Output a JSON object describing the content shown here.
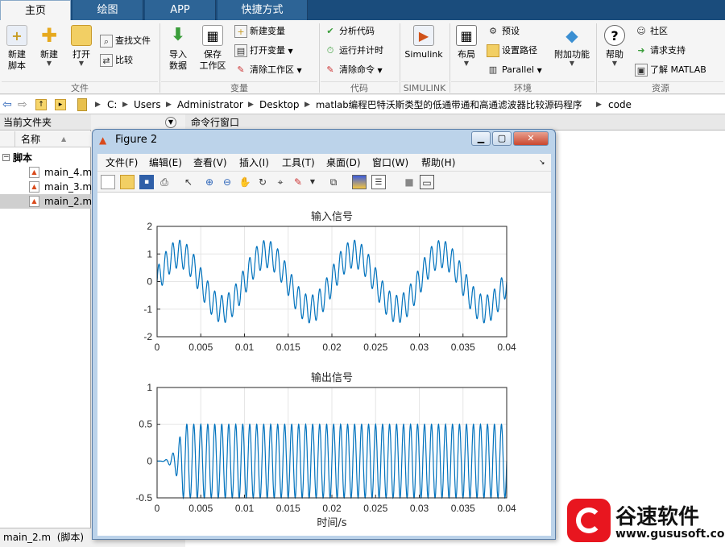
{
  "tabs": [
    {
      "label": "主页"
    },
    {
      "label": "绘图"
    },
    {
      "label": "APP"
    },
    {
      "label": "快捷方式"
    }
  ],
  "ribbon": {
    "new_script": "新建\n脚本",
    "new": "新建",
    "open": "打开",
    "find_files": "查找文件",
    "compare": "比较",
    "import_data": "导入\n数据",
    "save_workspace": "保存\n工作区",
    "new_variable": "新建变量",
    "open_variable": "打开变量",
    "clear_workspace": "清除工作区",
    "analyze_code": "分析代码",
    "run_and_time": "运行并计时",
    "clear_commands": "清除命令",
    "simulink": "Simulink",
    "layout": "布局",
    "preferences": "预设",
    "set_path": "设置路径",
    "parallel": "Parallel",
    "addons": "附加功能",
    "help": "帮助",
    "community": "社区",
    "request_support": "请求支持",
    "learn_matlab": "了解 MATLAB",
    "groups": {
      "file": "文件",
      "variable": "变量",
      "code": "代码",
      "simulink": "SIMULINK",
      "environment": "环境",
      "resources": "资源"
    }
  },
  "address": {
    "segments": [
      "C:",
      "Users",
      "Administrator",
      "Desktop",
      "matlab编程巴特沃斯类型的低通带通和高通滤波器比较源码程序",
      "code"
    ]
  },
  "left_panel": {
    "title": "当前文件夹",
    "column": "名称",
    "sort_marker": "▲",
    "group": "脚本",
    "files": [
      "main_4.m",
      "main_3.m",
      "main_2.m"
    ],
    "status": "main_2.m  (脚本)"
  },
  "command_window": {
    "title": "命令行窗口"
  },
  "figure": {
    "title": "Figure 2",
    "menu": [
      "文件(F)",
      "编辑(E)",
      "查看(V)",
      "插入(I)",
      "工具(T)",
      "桌面(D)",
      "窗口(W)",
      "帮助(H)"
    ],
    "toolbar_icons": [
      "new-figure-icon",
      "open-icon",
      "save-icon",
      "print-icon",
      "pointer-icon",
      "zoom-in-icon",
      "zoom-out-icon",
      "pan-icon",
      "rotate-icon",
      "datatip-icon",
      "brush-icon",
      "link-icon",
      "colorbar-icon",
      "legend-icon",
      "hide-tools-icon",
      "show-tools-icon"
    ]
  },
  "chart_data": [
    {
      "type": "line",
      "title": "输入信号",
      "xlabel": "",
      "ylabel": "",
      "xlim": [
        0,
        0.04
      ],
      "ylim": [
        -2,
        2
      ],
      "xticks": [
        "0",
        "0.005",
        "0.01",
        "0.015",
        "0.02",
        "0.025",
        "0.03",
        "0.035",
        "0.04"
      ],
      "yticks": [
        "2",
        "1",
        "0",
        "-1",
        "-2"
      ],
      "signal": {
        "components": [
          {
            "amplitude": 1,
            "frequency_hz": 100
          },
          {
            "amplitude": 0.5,
            "frequency_hz": 1250
          }
        ]
      },
      "color": "#0072bd",
      "grid": true
    },
    {
      "type": "line",
      "title": "输出信号",
      "xlabel": "时间/s",
      "ylabel": "",
      "xlim": [
        0,
        0.04
      ],
      "ylim": [
        -0.5,
        1
      ],
      "xticks": [
        "0",
        "0.005",
        "0.01",
        "0.015",
        "0.02",
        "0.025",
        "0.03",
        "0.035",
        "0.04"
      ],
      "yticks": [
        "1",
        "0.5",
        "0",
        "-0.5"
      ],
      "signal": {
        "amplitude": 0.5,
        "frequency_hz": 1250,
        "settle_time_s": 0.003
      },
      "color": "#0072bd",
      "grid": true
    }
  ],
  "watermark": {
    "brand": "谷速软件",
    "url": "www.gususoft.com",
    "color": "#e8161f"
  }
}
